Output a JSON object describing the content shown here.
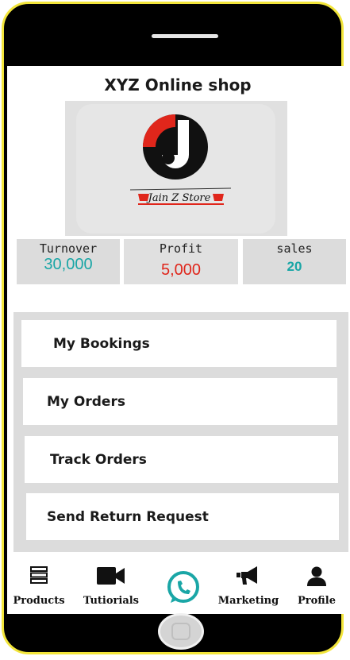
{
  "shop_title": "XYZ Online shop",
  "logo": {
    "brand_text": "Jain Z Store",
    "icon": "jain-store-logo"
  },
  "stats": [
    {
      "label": "Turnover",
      "value": "30,000",
      "color": "#1aa6a6"
    },
    {
      "label": "Profit",
      "value": "5,000",
      "color": "#e0261b"
    },
    {
      "label": "sales",
      "value": "20",
      "color": "#1aa6a6"
    }
  ],
  "menu": [
    {
      "label": "My Bookings"
    },
    {
      "label": "My Orders"
    },
    {
      "label": "Track Orders"
    },
    {
      "label": "Send Return Request"
    }
  ],
  "nav": [
    {
      "label": "Products",
      "icon": "list-icon"
    },
    {
      "label": "Tutiorials",
      "icon": "video-camera-icon"
    },
    {
      "label": "",
      "icon": "whatsapp-icon"
    },
    {
      "label": "Marketing",
      "icon": "megaphone-icon"
    },
    {
      "label": "Profile",
      "icon": "user-icon"
    }
  ],
  "colors": {
    "frame_accent": "#f2e53a",
    "whatsapp": "#1aa6a6",
    "logo_red": "#e0261b"
  }
}
